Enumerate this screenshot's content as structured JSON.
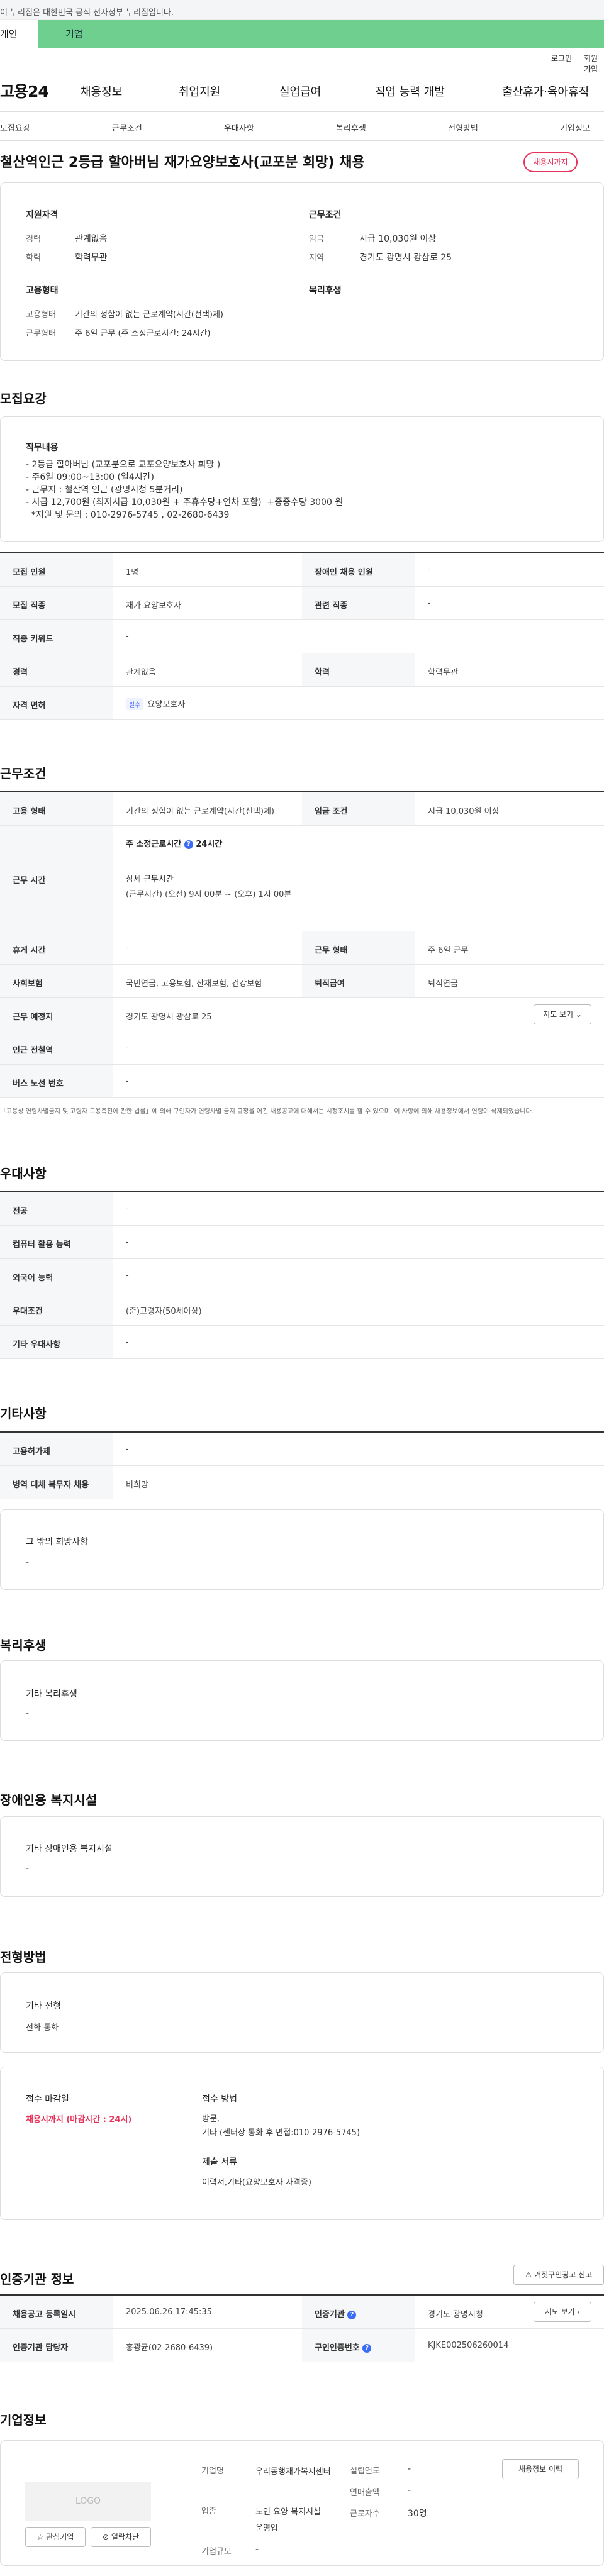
{
  "gov_banner": "이 누리집은 대한민국 공식 전자정부 누리집입니다.",
  "tabs": {
    "individual": "개인",
    "enterprise": "기업"
  },
  "util": {
    "login": "로그인",
    "join": "회원가입"
  },
  "brand": "고용24",
  "gnb": [
    "채용정보",
    "취업지원",
    "실업급여",
    "직업 능력 개발",
    "출산휴가·육아휴직"
  ],
  "subnav": [
    "모집요강",
    "근무조건",
    "우대사항",
    "복리후생",
    "전형방법",
    "기업정보"
  ],
  "job": {
    "title": "철산역인근 2등급 할아버님 재가요양보호사(교포분 희망) 채용",
    "status_badge": "채용시까지"
  },
  "summary": {
    "qual_title": "지원자격",
    "cond_title": "근무조건",
    "career_label": "경력",
    "career": "관계없음",
    "edu_label": "학력",
    "edu": "학력무관",
    "wage_label": "임금",
    "wage": "시급 10,030원 이상",
    "region_label": "지역",
    "region": "경기도 광명시 광삼로 25",
    "emp_title": "고용형태",
    "welfare_title": "복리후생",
    "emp_type_label": "고용형태",
    "emp_type": "기간의 정함이 없는 근로계약(시간(선택)제)",
    "work_type_label": "근무형태",
    "work_type": "주 6일 근무 (주 소정근로시간: 24시간)"
  },
  "recruit": {
    "title": "모집요강",
    "duty_title": "직무내용",
    "duty_text": "- 2등급 할아버님 (교포분으로 교포요양보호사 희망 )\n- 주6일 09:00~13:00 (일4시간)\n- 근무지 : 철산역 인근 (광명시청 5분거리)\n- 시급 12,700원 (최저시급 10,030원 + 주휴수당+연차 포함)  +증증수당 3000 원\n  *지원 및 문의 : 010-2976-5745 , 02-2680-6439",
    "headcount_label": "모집 인원",
    "headcount": "1명",
    "disabled_label": "장애인 채용 인원",
    "disabled": "-",
    "job_label": "모집 직종",
    "job": "재가 요양보호사",
    "related_label": "관련 직종",
    "related": "-",
    "keyword_label": "직종 키워드",
    "keyword": "-",
    "career_label": "경력",
    "career": "관계없음",
    "edu_label": "학력",
    "edu": "학력무관",
    "license_label": "자격 면허",
    "license_tag": "필수",
    "license": "요양보호사"
  },
  "conditions": {
    "title": "근무조건",
    "emp_label": "고용 형태",
    "emp": "기간의 정함이 없는 근로계약(시간(선택)제)",
    "wage_label": "임금 조건",
    "wage": "시급 10,030원 이상",
    "hours_label": "근무 시간",
    "weekly": "주 소정근로시간",
    "weekly_val": "24시간",
    "detail_title": "상세 근무시간",
    "detail": "(근무시간) (오전) 9시 00분 ~ (오후) 1시 00분",
    "rest_label": "휴게 시간",
    "rest": "-",
    "form_label": "근무 형태",
    "form": "주 6일 근무",
    "insurance_label": "사회보험",
    "insurance": "국민연금, 고용보험, 산재보험, 건강보험",
    "retire_label": "퇴직급여",
    "retire": "퇴직연금",
    "place_label": "근무 예정지",
    "place": "경기도 광명시 광삼로 25",
    "map_btn": "지도 보기",
    "subway_label": "인근 전철역",
    "subway": "-",
    "bus_label": "버스 노선 번호",
    "bus": "-",
    "note": "「고용상 연령차별금지 및 고령자 고용촉진에 관한 법률」에 의해 구인자가 연령차별 금지 규정을 어긴 채용공고에 대해서는 시정조치를 할 수 있으며, 이 사항에 의해 채용정보에서 연령이 삭제되었습니다."
  },
  "preference": {
    "title": "우대사항",
    "major_label": "전공",
    "major": "-",
    "computer_label": "컴퓨터 활용 능력",
    "computer": "-",
    "lang_label": "외국어 능력",
    "lang": "-",
    "cond_label": "우대조건",
    "cond": "(준)고령자(50세이상)",
    "etc_label": "기타 우대사항",
    "etc": "-"
  },
  "others": {
    "title": "기타사항",
    "vehicle_label": "고용허가제",
    "vehicle": "-",
    "army_label": "병역 대체 복무자 채용",
    "army": "비희망",
    "wish_title": "그 밖의 희망사항",
    "wish": "-"
  },
  "welfare": {
    "title": "복리후생",
    "sub": "기타 복리후생",
    "val": "-"
  },
  "disabled_facility": {
    "title": "장애인용 복지시설",
    "sub": "기타 장애인용 복지시설",
    "val": "-"
  },
  "selection": {
    "title": "전형방법",
    "etc_title": "기타 전형",
    "etc": "전화 통화",
    "deadline_title": "접수 마감일",
    "deadline": "채용시까지 (마감시간 : 24시)",
    "method_title": "접수 방법",
    "method": "방문,\n기타 (센터장 통화 후 면접:010-2976-5745)",
    "docs_title": "제출 서류",
    "docs": "이력서,기타(요양보호사 자격증)"
  },
  "agency": {
    "title": "인증기관 정보",
    "report_btn": "거짓구인광고 신고",
    "reg_label": "채용공고 등록일시",
    "reg": "2025.06.26 17:45:35",
    "agency_label": "인증기관",
    "agency": "경기도 광명시청",
    "map_btn": "지도 보기",
    "mgr_label": "인증기관 담당자",
    "mgr": "홍광균(02-2680-6439)",
    "no_label": "구인인증번호",
    "no": "KJKE002506260014"
  },
  "company": {
    "title": "기업정보",
    "logo": "LOGO",
    "fav_btn": "관심기업",
    "block_btn": "열람차단",
    "name_label": "기업명",
    "name": "우리동행재가복지센터",
    "industry_label": "업종",
    "industry": "노인 요양 복지시설 운영업",
    "size_label": "기업규모",
    "size": "-",
    "found_label": "설립연도",
    "found": "-",
    "sales_label": "연매출액",
    "sales": "-",
    "emp_label": "근로자수",
    "emp": "30명",
    "history_btn": "채용정보 이력"
  }
}
